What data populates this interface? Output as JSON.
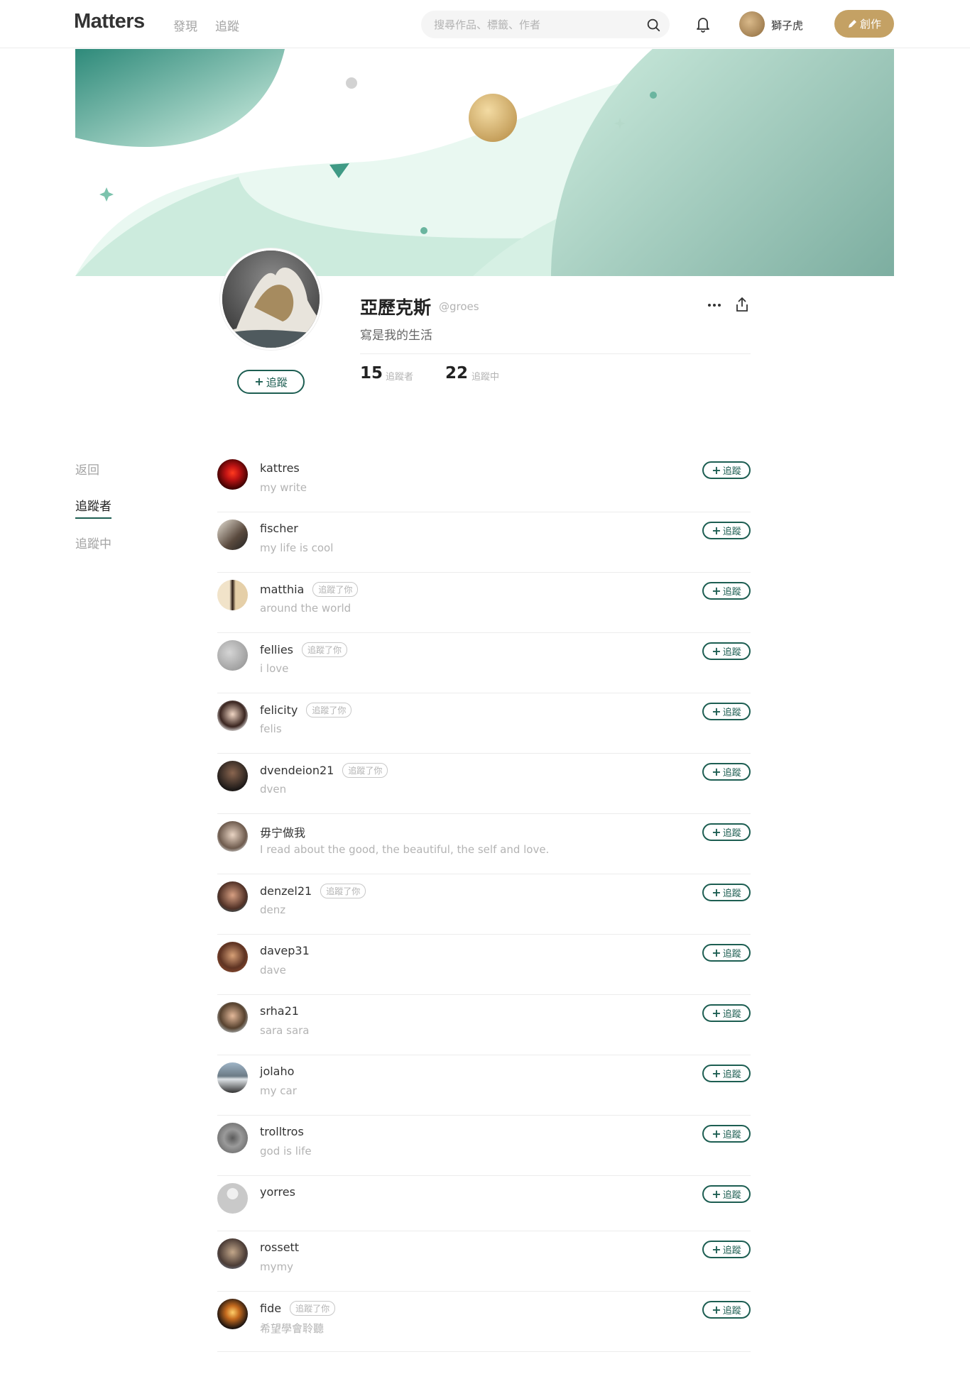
{
  "header": {
    "logo": "Matters",
    "nav": {
      "discover": "發現",
      "follow": "追蹤"
    },
    "search": {
      "placeholder": "搜尋作品、標籤、作者",
      "value": ""
    },
    "user_name": "獅子虎",
    "write_label": "創作"
  },
  "profile": {
    "display_name": "亞歷克斯",
    "handle": "@groes",
    "bio": "寫是我的生活",
    "follow_label": "追蹤",
    "followers_count": "15",
    "followers_label": "追蹤者",
    "following_count": "22",
    "following_label": "追蹤中"
  },
  "side_nav": {
    "back": "返回",
    "followers": "追蹤者",
    "following": "追蹤中"
  },
  "follow_button_label": "追蹤",
  "followers": [
    {
      "name": "kattres",
      "desc": "my write",
      "badge": ""
    },
    {
      "name": "fischer",
      "desc": "my life is cool",
      "badge": ""
    },
    {
      "name": "matthia",
      "desc": "around the world",
      "badge": "追蹤了你"
    },
    {
      "name": "fellies",
      "desc": "i love",
      "badge": "追蹤了你"
    },
    {
      "name": "felicity",
      "desc": "felis",
      "badge": "追蹤了你"
    },
    {
      "name": "dvendeion21",
      "desc": "dven",
      "badge": "追蹤了你"
    },
    {
      "name": "毋宁做我",
      "desc": "I read about the good, the beautiful, the self and love.",
      "badge": ""
    },
    {
      "name": "denzel21",
      "desc": "denz",
      "badge": "追蹤了你"
    },
    {
      "name": "davep31",
      "desc": "dave",
      "badge": ""
    },
    {
      "name": "srha21",
      "desc": "sara sara",
      "badge": ""
    },
    {
      "name": "jolaho",
      "desc": "my car",
      "badge": ""
    },
    {
      "name": "trolltros",
      "desc": "god is life",
      "badge": ""
    },
    {
      "name": "yorres",
      "desc": "",
      "badge": ""
    },
    {
      "name": "rossett",
      "desc": "mymy",
      "badge": ""
    },
    {
      "name": "fide",
      "desc": "希望學會聆聽",
      "badge": "追蹤了你"
    }
  ],
  "colors": {
    "accent_green": "#1d5e52",
    "gold": "#c4a164"
  }
}
